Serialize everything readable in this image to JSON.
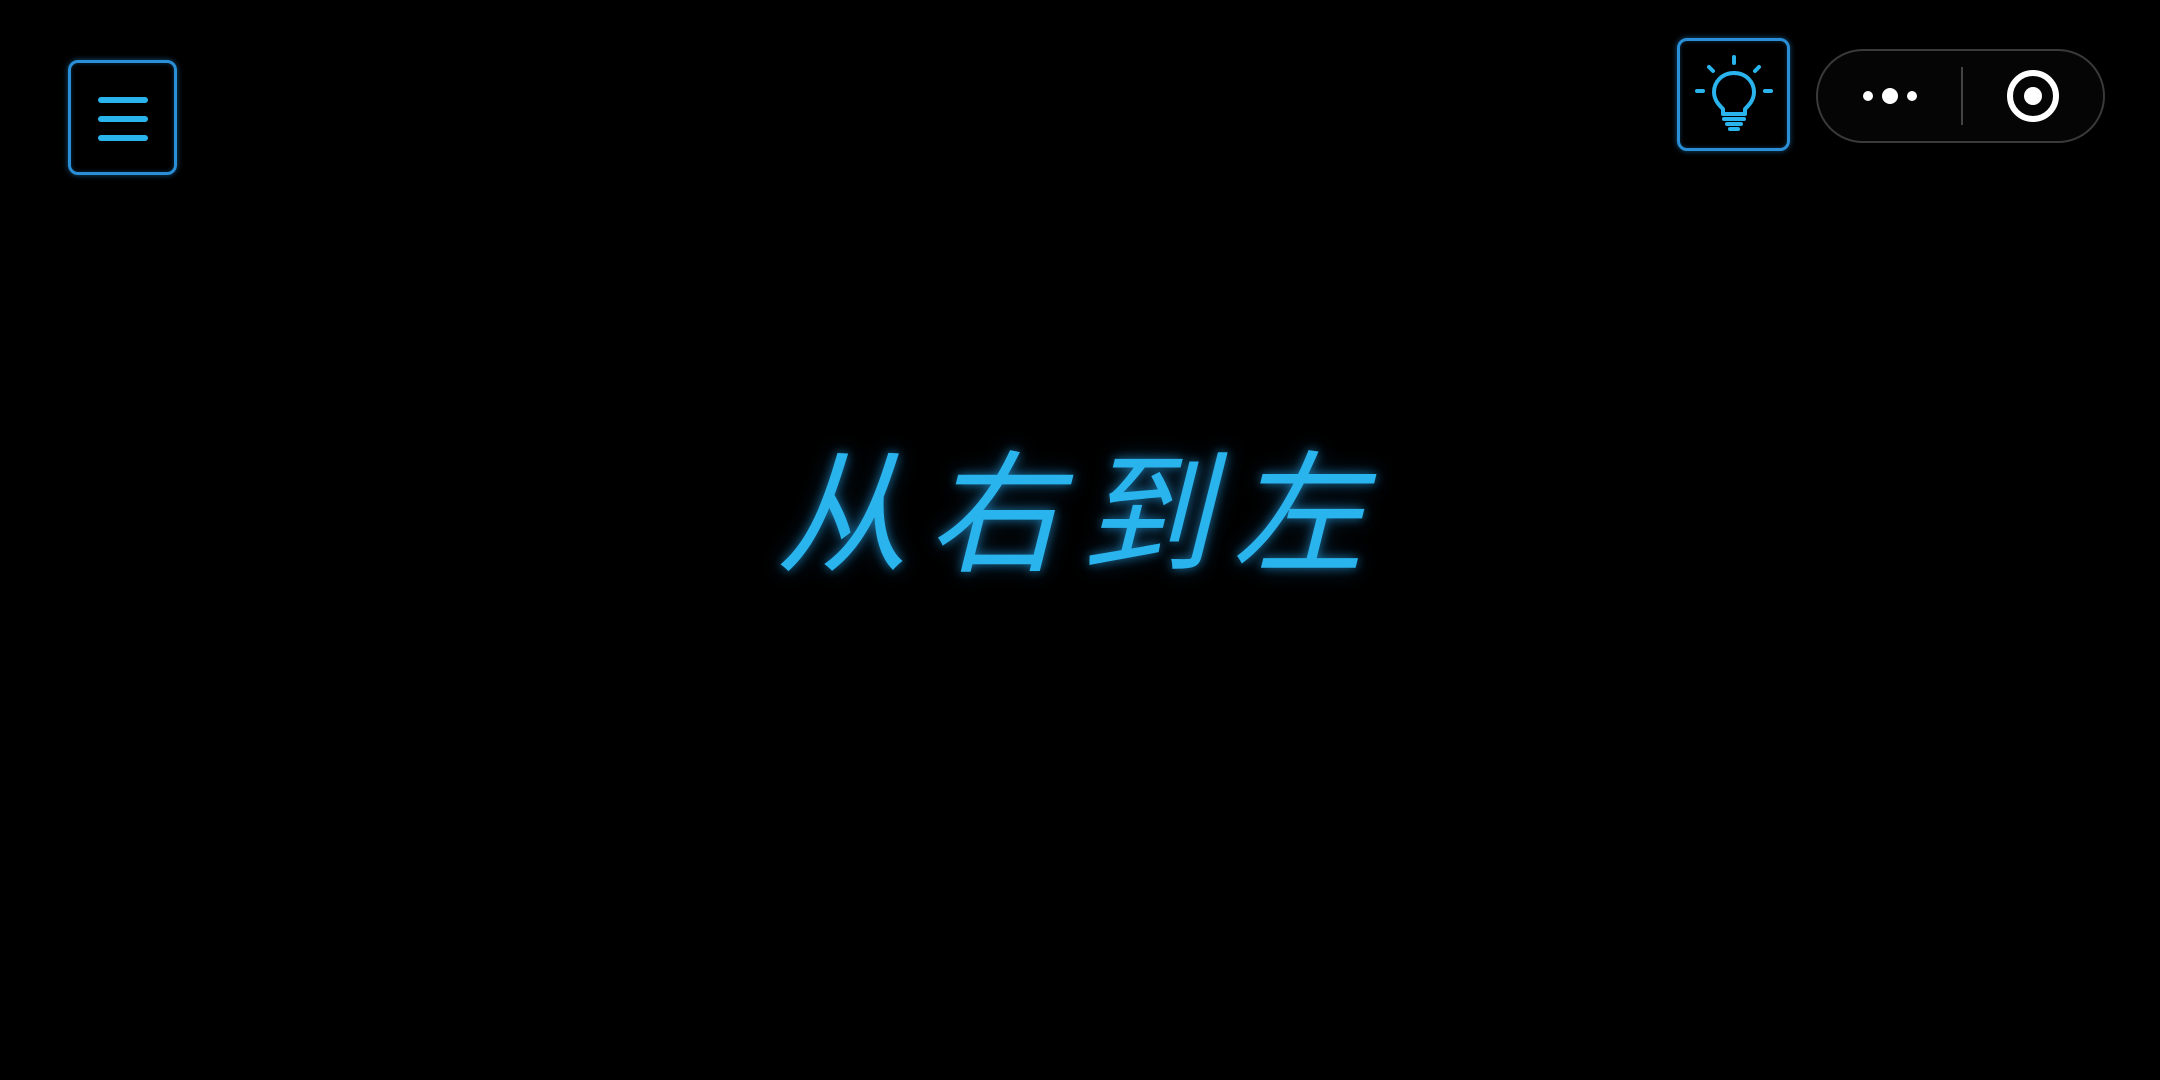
{
  "display": {
    "text": "从右到左"
  },
  "toolbar": {
    "menu_icon": "hamburger-menu-icon",
    "light_icon": "lightbulb-icon",
    "more_icon": "more-dots-icon",
    "close_icon": "target-circle-icon"
  },
  "colors": {
    "background": "#000000",
    "neon_blue": "#2ab4ee",
    "button_border": "#2a8fd6",
    "capsule_border": "#3a3a3a"
  }
}
